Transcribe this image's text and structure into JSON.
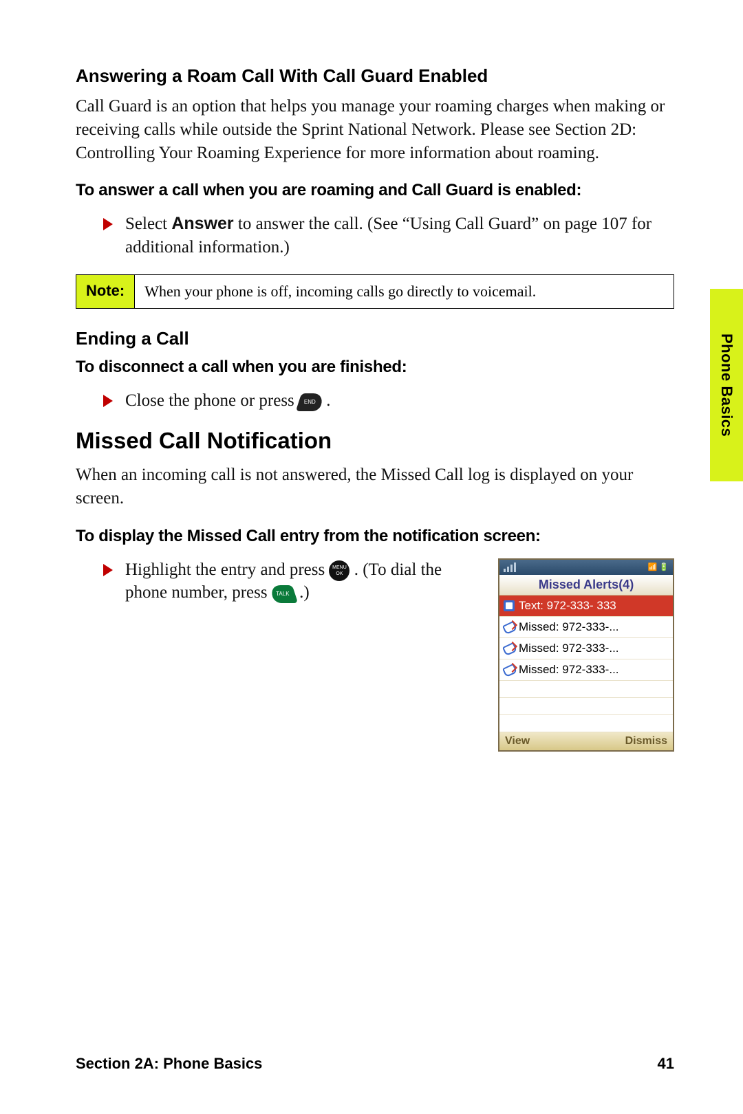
{
  "sideTab": "Phone Basics",
  "h1": "Answering a Roam Call With Call Guard Enabled",
  "p1": "Call Guard is an option that helps you manage your roaming charges when making or receiving calls while outside the Sprint National Network. Please see Section 2D: Controlling Your Roaming Experience for more information about roaming.",
  "lead1": "To answer a call when you are roaming and Call Guard is enabled:",
  "bullet1_pre": "Select ",
  "bullet1_b": "Answer",
  "bullet1_post": " to answer the call. (See “Using Call Guard” on page 107 for additional information.)",
  "noteLabel": "Note:",
  "noteBody": "When your phone is off, incoming calls go directly to voicemail.",
  "h2": "Ending a Call",
  "lead2": "To disconnect a call when you are finished:",
  "bullet2": "Close the phone or press ",
  "sectionTitle": "Missed Call Notification",
  "p2": "When an incoming call is not answered, the Missed Call log is displayed on your screen.",
  "lead3": "To display the Missed Call entry from the notification screen:",
  "bullet3a": "Highlight the entry and press ",
  "bullet3b": ". (To dial the phone number, press ",
  "bullet3c": " .)",
  "phone": {
    "title": "Missed Alerts(4)",
    "rows": [
      {
        "type": "text",
        "label": "Text: 972-333- 333"
      },
      {
        "type": "miss",
        "label": "Missed: 972-333-..."
      },
      {
        "type": "miss",
        "label": "Missed: 972-333-..."
      },
      {
        "type": "miss",
        "label": "Missed: 972-333-..."
      }
    ],
    "softLeft": "View",
    "softRight": "Dismiss"
  },
  "footerLeft": "Section 2A: Phone Basics",
  "footerRight": "41"
}
